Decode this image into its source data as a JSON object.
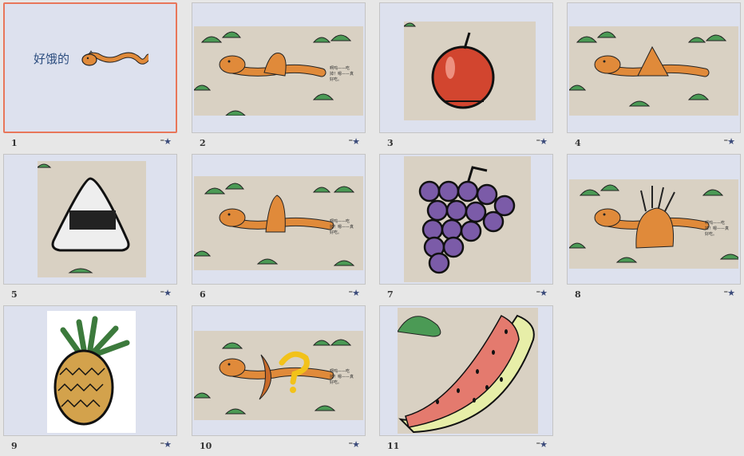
{
  "slides": [
    {
      "number": "1",
      "title": "好饿的",
      "selected": true
    },
    {
      "number": "2",
      "caption": "啊呜——吃掉！嗯——真好吃。"
    },
    {
      "number": "3"
    },
    {
      "number": "4"
    },
    {
      "number": "5"
    },
    {
      "number": "6",
      "caption": "啊呜——吃掉！嗯——真好吃。"
    },
    {
      "number": "7"
    },
    {
      "number": "8",
      "caption": "啊呜——吃掉！嗯——真好吃。"
    },
    {
      "number": "9"
    },
    {
      "number": "10",
      "caption": "啊呜——吃掉！嗯——真好吃。"
    },
    {
      "number": "11"
    }
  ],
  "transition_icon": "slide-transition-star-icon",
  "colors": {
    "selection_border": "#e8765a",
    "slide_bg": "#dde1ee",
    "panel_bg": "#e7e7e7"
  }
}
